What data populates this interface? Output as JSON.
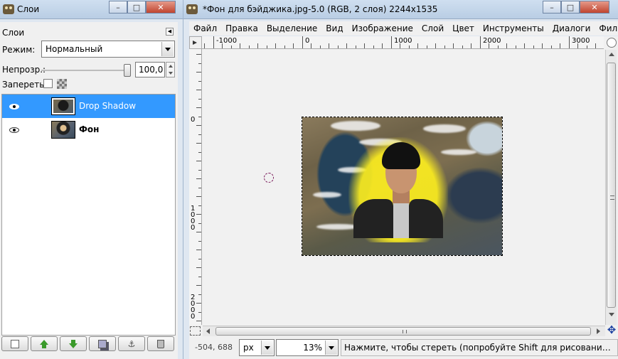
{
  "layers_window": {
    "title": "Слои",
    "dock_title": "Слои",
    "mode_label": "Режим:",
    "mode_value": "Нормальный",
    "opacity_label": "Непрозр.:",
    "opacity_value": "100,0",
    "opacity_fraction": 1.0,
    "lock_label": "Запереть:",
    "layers": [
      {
        "name": "Drop Shadow",
        "visible": true,
        "selected": true,
        "bold": false
      },
      {
        "name": "Фон",
        "visible": true,
        "selected": false,
        "bold": true
      }
    ],
    "bottom_buttons": [
      "new-layer-icon",
      "raise-layer-icon",
      "lower-layer-icon",
      "duplicate-layer-icon",
      "anchor-layer-icon",
      "delete-layer-icon"
    ]
  },
  "image_window": {
    "title": "*Фон для бэйджика.jpg-5.0 (RGB, 2 слоя) 2244x1535",
    "menu": [
      "Файл",
      "Правка",
      "Выделение",
      "Вид",
      "Изображение",
      "Слой",
      "Цвет",
      "Инструменты",
      "Диалоги",
      "Фильтры"
    ],
    "hruler_labels": [
      "-1000",
      "0",
      "1000",
      "2000",
      "3000"
    ],
    "vruler_labels": [
      "0",
      "1000",
      "2000"
    ],
    "status": {
      "coords": "-504, 688",
      "unit": "px",
      "zoom": "13%",
      "message": "Нажмите, чтобы стереть (попробуйте Shift для рисования прямой линии)"
    }
  },
  "colors": {
    "selection": "#3399ff",
    "titlebar": "#c4d6ea",
    "glow": "#ffe600"
  }
}
